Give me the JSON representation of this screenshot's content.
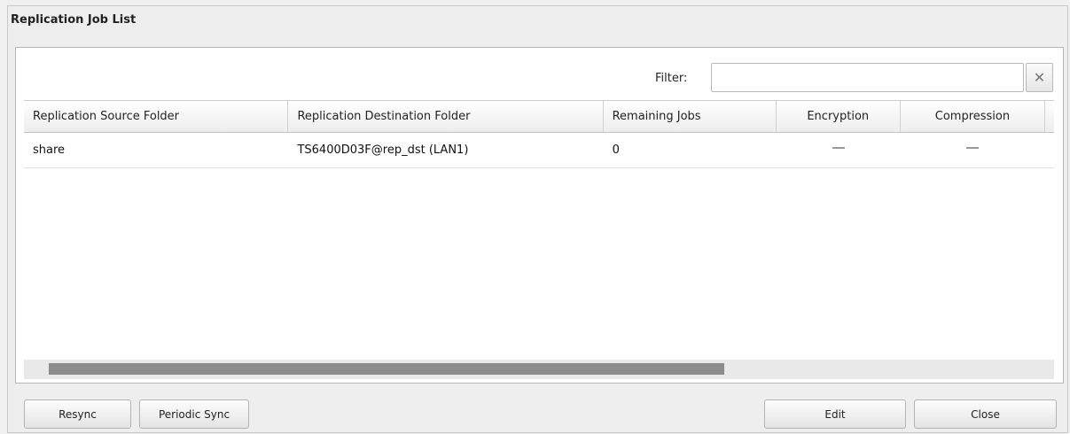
{
  "dialog": {
    "title": "Replication Job List"
  },
  "filter": {
    "label": "Filter:",
    "value": "",
    "placeholder": "",
    "clear_icon": "close-icon"
  },
  "table": {
    "columns": [
      "Replication Source Folder",
      "Replication Destination Folder",
      "Remaining Jobs",
      "Encryption",
      "Compression"
    ],
    "rows": [
      {
        "source": "share",
        "destination": "TS6400D03F@rep_dst (LAN1)",
        "remaining": "0",
        "encryption": "—",
        "compression": "—"
      }
    ]
  },
  "buttons": {
    "resync": "Resync",
    "periodic_sync": "Periodic Sync",
    "edit": "Edit",
    "close": "Close"
  }
}
